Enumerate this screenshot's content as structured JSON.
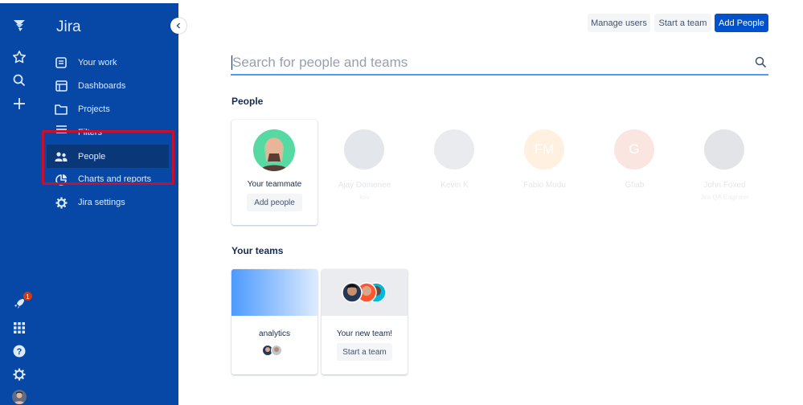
{
  "rail": {
    "icons": [
      "jira-logo-icon",
      "star-icon",
      "search-icon",
      "plus-icon",
      "rocket-icon",
      "app-switcher-icon",
      "help-icon",
      "settings-icon"
    ],
    "notification_count": "1"
  },
  "sidebar": {
    "title": "Jira",
    "items": [
      {
        "label": "Your work",
        "icon": "your-work-icon"
      },
      {
        "label": "Dashboards",
        "icon": "dashboard-icon"
      },
      {
        "label": "Projects",
        "icon": "folder-icon"
      },
      {
        "label": "Filters",
        "icon": "filter-icon"
      },
      {
        "label": "People",
        "icon": "people-icon",
        "active": true
      },
      {
        "label": "Charts and reports",
        "icon": "chart-icon"
      },
      {
        "label": "Jira settings",
        "icon": "gear-icon"
      }
    ]
  },
  "header": {
    "manage_users": "Manage users",
    "start_team": "Start a team",
    "add_people": "Add People"
  },
  "search": {
    "placeholder": "Search for people and teams"
  },
  "people": {
    "heading": "People",
    "teammate_label": "Your teammate",
    "add_people_label": "Add people",
    "faded_cards": [
      {
        "name": "Ajay Domenee",
        "sub": "kov",
        "initials": "",
        "color": "#253858"
      },
      {
        "name": "Kevin K",
        "sub": "",
        "initials": "",
        "color": "#505f79"
      },
      {
        "name": "Fabio Modu",
        "sub": "",
        "initials": "FM",
        "color": "#ff8b00"
      },
      {
        "name": "Gfiab",
        "sub": "",
        "initials": "G",
        "color": "#de350b"
      },
      {
        "name": "John Foxed",
        "sub": "Jira QA Engineer",
        "initials": "",
        "color": "#172b4d"
      }
    ]
  },
  "teams": {
    "heading": "Your teams",
    "team_name": "analytics",
    "new_team_label": "Your new team!",
    "start_team_label": "Start a team"
  },
  "colors": {
    "nav_bg": "#0747a6",
    "primary": "#0052cc",
    "highlight": "#c8102e"
  }
}
